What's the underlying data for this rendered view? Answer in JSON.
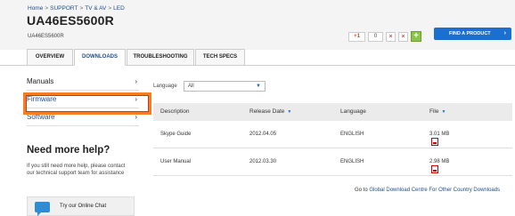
{
  "breadcrumb": [
    "Home",
    "SUPPORT",
    "TV & AV",
    "LED"
  ],
  "breadcrumb_sep": ">",
  "model": {
    "title": "UA46ES5600R",
    "subtitle": "UA46ES5600R"
  },
  "social": {
    "gplus_label": "+1",
    "gplus_count": "0",
    "btn1": "×",
    "btn2": "×",
    "btn3": "+"
  },
  "find_product": {
    "label": "FIND A PRODUCT",
    "arrow": "›"
  },
  "tabs": [
    {
      "label": "OVERVIEW"
    },
    {
      "label": "DOWNLOADS"
    },
    {
      "label": "TROUBLESHOOTING"
    },
    {
      "label": "TECH SPECS"
    }
  ],
  "sidebar": {
    "items": [
      {
        "label": "Manuals",
        "chev": "›"
      },
      {
        "label": "Firmware",
        "chev": "›"
      },
      {
        "label": "Software",
        "chev": "›"
      }
    ]
  },
  "help": {
    "title": "Need more help?",
    "text": "If you still need more help, please contact our technical support team for assistance",
    "chat_label": "Try our Online Chat"
  },
  "filter": {
    "label": "Language",
    "value": "All",
    "caret": "▼"
  },
  "table": {
    "headers": {
      "description": "Description",
      "release_date": "Release Date",
      "language": "Language",
      "file": "File"
    },
    "sort_icon": "▼",
    "rows": [
      {
        "description": "Skype Guide",
        "date": "2012.04.05",
        "language": "ENGLISH",
        "size": "3.01 MB"
      },
      {
        "description": "User Manual",
        "date": "2012.03.30",
        "language": "ENGLISH",
        "size": "2.98 MB"
      }
    ]
  },
  "footer": {
    "prefix": "Go to",
    "link": "Global Download Centre For Other Country Downloads"
  },
  "colors": {
    "accent": "#1a6fd0",
    "highlight": "#f57f20",
    "link": "#1f4e8c"
  }
}
